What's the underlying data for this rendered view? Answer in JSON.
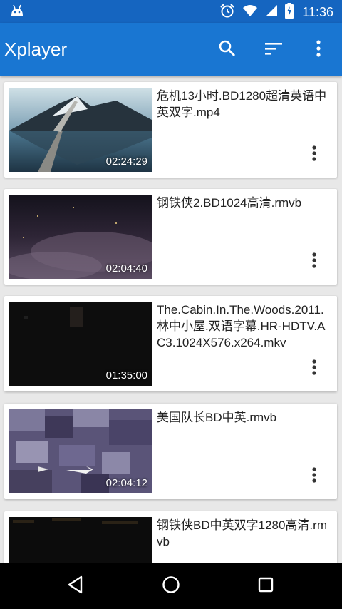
{
  "status": {
    "time": "11:36"
  },
  "app_bar": {
    "title": "Xplayer",
    "icons": [
      "search-icon",
      "sort-icon",
      "more-vert-icon"
    ]
  },
  "videos": [
    {
      "title": "危机13小时.BD1280超清英语中英双字.mp4",
      "duration": "02:24:29"
    },
    {
      "title": "钢铁侠2.BD1024高清.rmvb",
      "duration": "02:04:40"
    },
    {
      "title": "The.Cabin.In.The.Woods.2011.林中小屋.双语字幕.HR-HDTV.AC3.1024X576.x264.mkv",
      "duration": "01:35:00"
    },
    {
      "title": "美国队长BD中英.rmvb",
      "duration": "02:04:12"
    },
    {
      "title": "钢铁侠BD中英双字1280高清.rmvb",
      "duration": ""
    }
  ],
  "nav": {
    "icons": [
      "back-icon",
      "home-icon",
      "recents-icon"
    ]
  },
  "colors": {
    "status_bar": "#1565c0",
    "app_bar": "#1976d2"
  }
}
